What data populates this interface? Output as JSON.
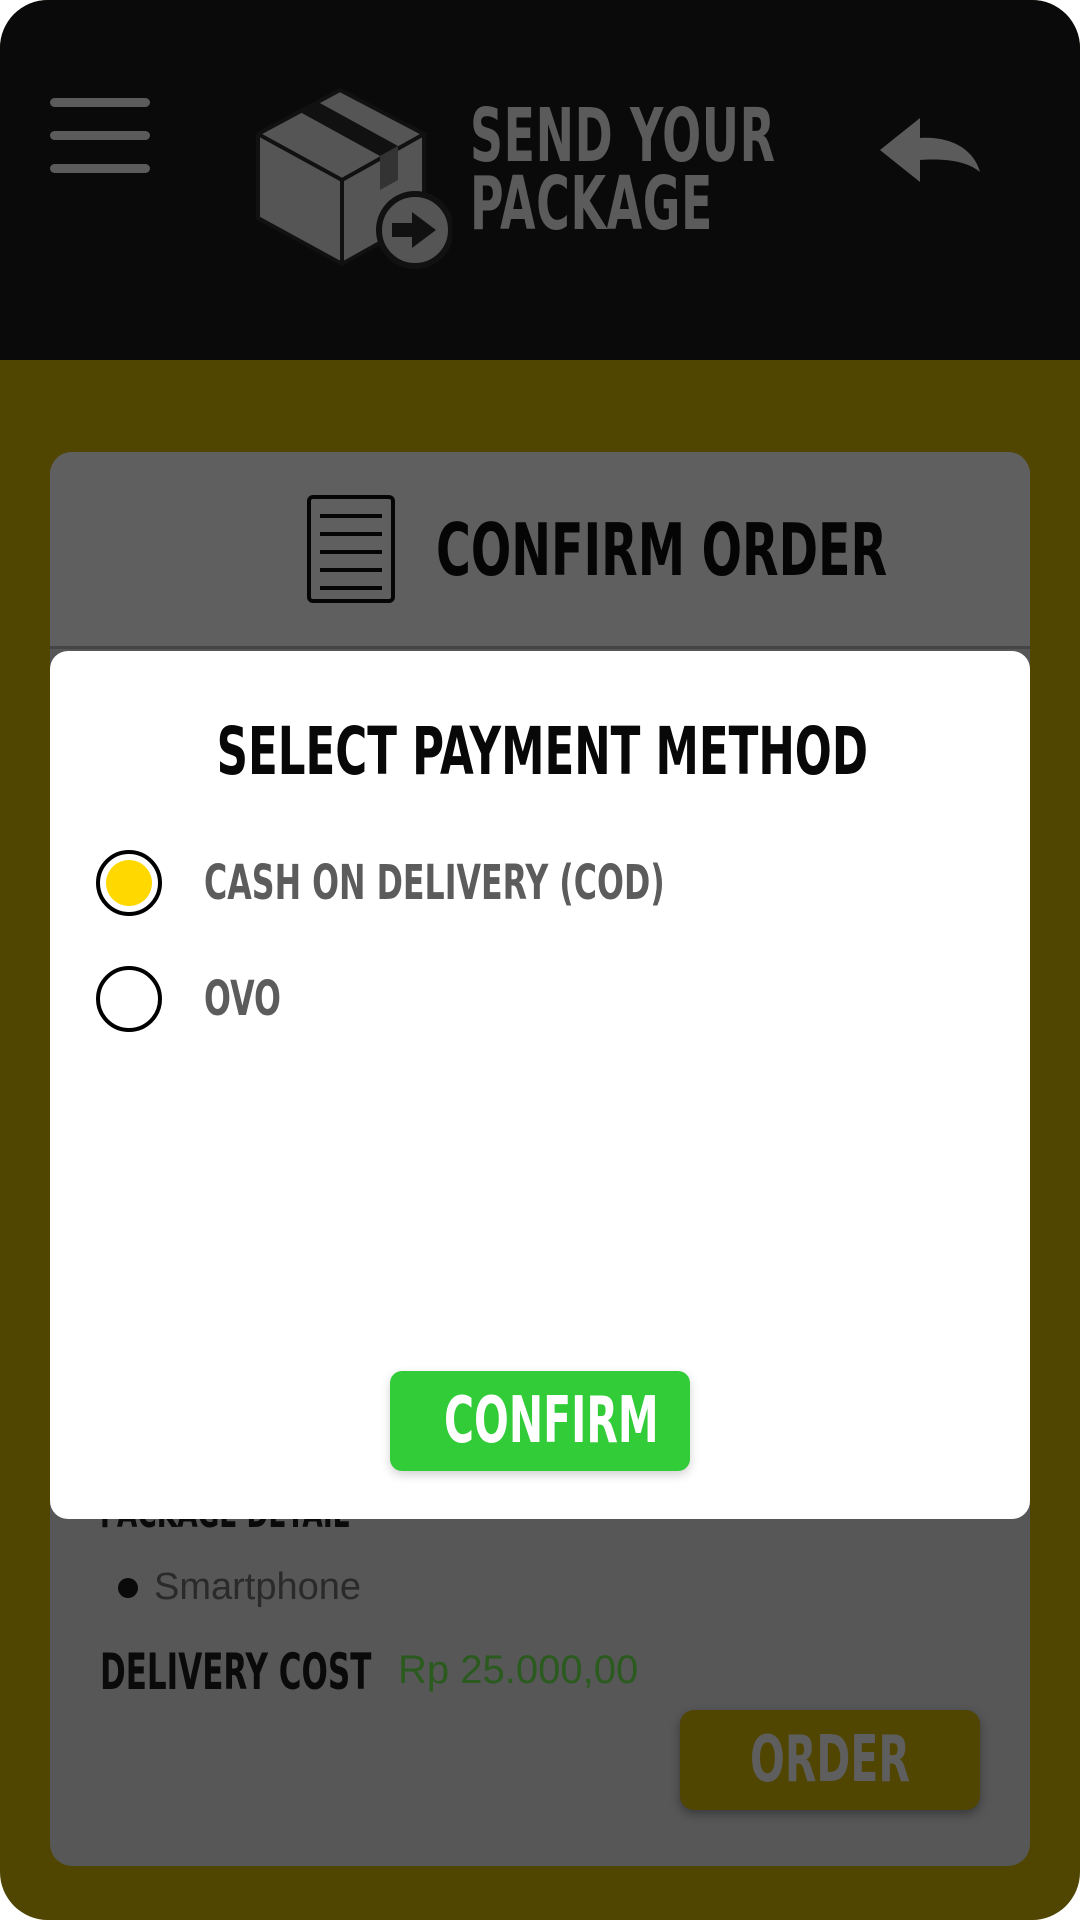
{
  "header": {
    "title_line1": "SEND YOUR",
    "title_line2": "PACKAGE",
    "menu_icon": "hamburger-menu-icon",
    "logo_icon": "package-send-icon",
    "back_icon": "back-arrow-icon"
  },
  "card": {
    "title": "CONFIRM ORDER",
    "title_icon": "document-icon",
    "package_detail_heading": "PACKAGE DETAIL",
    "items": [
      "Smartphone"
    ],
    "delivery_cost_label": "DELIVERY COST",
    "delivery_cost_value": "Rp 25.000,00",
    "order_button": "ORDER"
  },
  "modal": {
    "title": "SELECT PAYMENT METHOD",
    "options": [
      {
        "label": "CASH ON DELIVERY (COD)",
        "selected": true
      },
      {
        "label": "OVO",
        "selected": false
      }
    ],
    "confirm_button": "CONFIRM"
  },
  "colors": {
    "page_background": "#504602",
    "header_background": "#0a0a0a",
    "card_background": "#575757",
    "radio_selected": "#ffd800",
    "confirm_button": "#33cc39",
    "cost_text": "#2a5a1e"
  }
}
